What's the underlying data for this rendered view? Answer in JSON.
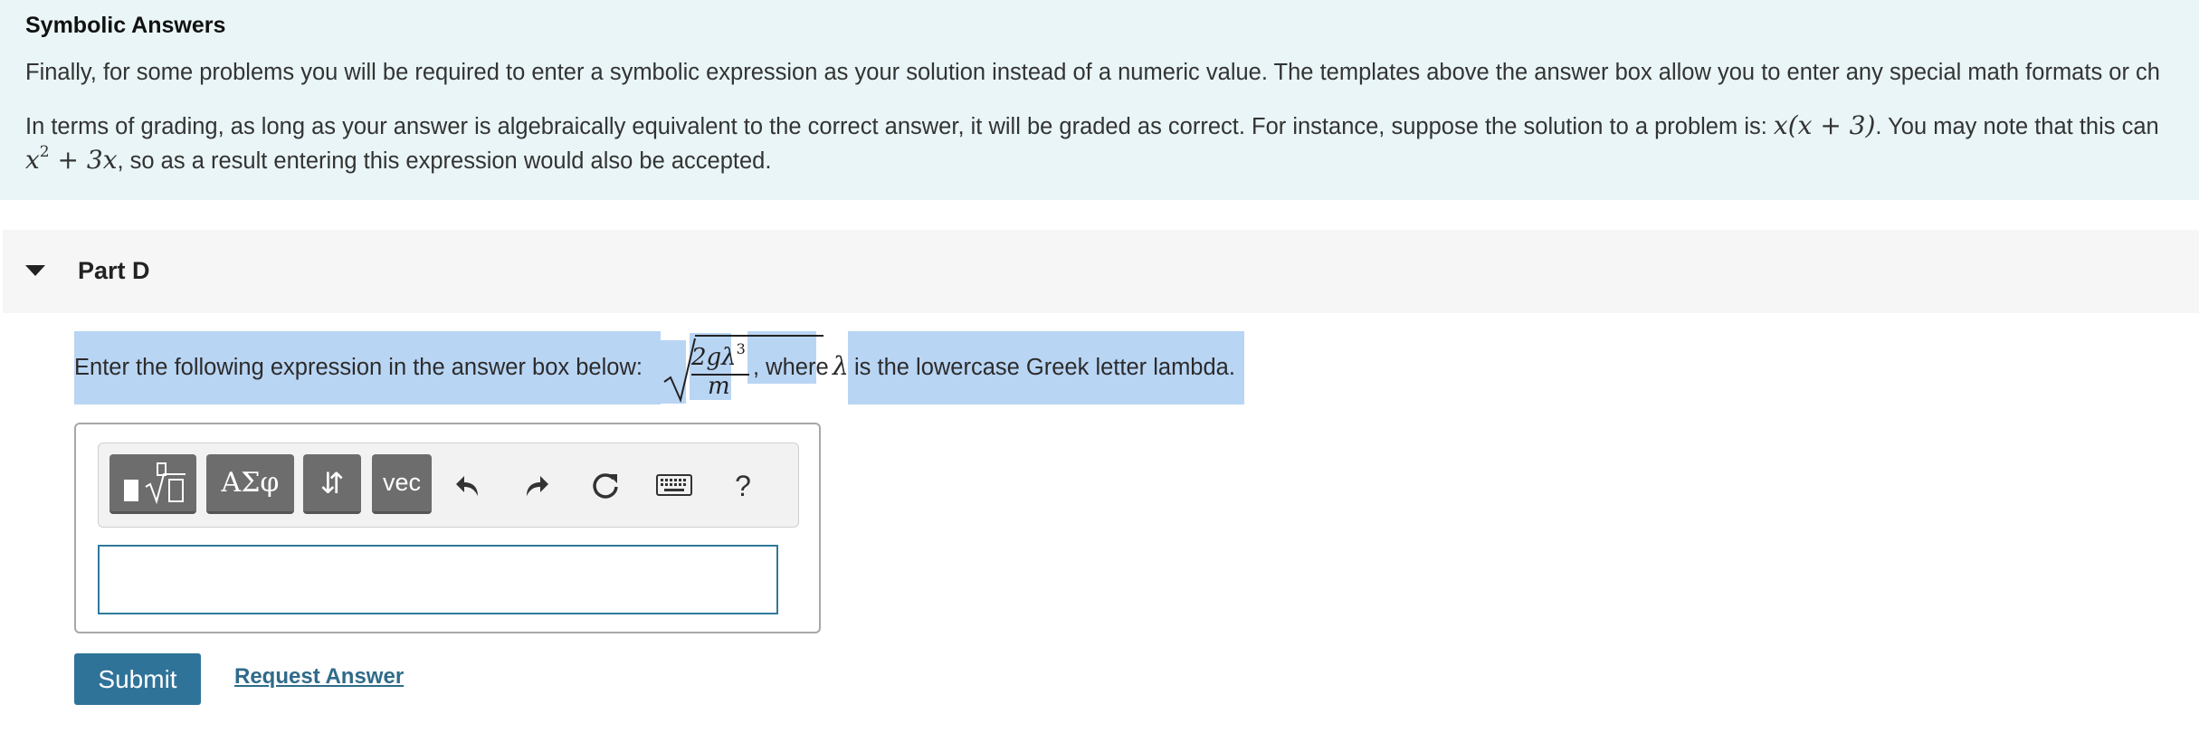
{
  "intro": {
    "title": "Symbolic Answers",
    "paragraph1": "Finally, for some problems you will be required to enter a symbolic expression as your solution instead of a numeric value. The templates above the answer box allow you to enter any special math formats or ch",
    "paragraph2_start": "In terms of grading, as long as your answer is algebraically equivalent to the correct answer, it will be graded as correct. For instance, suppose the solution to a problem is: ",
    "paragraph2_math": "x(x + 3)",
    "paragraph2_end": ". You may note that this can",
    "paragraph3_math_base": "x",
    "paragraph3_math_exp": "2",
    "paragraph3_math_rest": " + 3x",
    "paragraph3_end": ", so as a result entering this expression would also be accepted."
  },
  "part": {
    "title": "Part D",
    "prompt_start": "Enter the following expression in the answer box below: ",
    "expr_numerator": "2gλ",
    "expr_exponent": "3",
    "expr_denominator": "m",
    "prompt_middle": ", where ",
    "lambda": "λ",
    "prompt_end": " is the lowercase Greek letter lambda."
  },
  "toolbar": {
    "greek_label": "ΑΣφ",
    "arrows_label": "⇵",
    "vec_label": "vec",
    "help_label": "?",
    "icons": [
      "templates-icon",
      "undo-icon",
      "redo-icon",
      "reset-icon",
      "keyboard-icon",
      "help-icon"
    ]
  },
  "answer": {
    "value": ""
  },
  "actions": {
    "submit_label": "Submit",
    "request_label": "Request Answer"
  },
  "colors": {
    "intro_bg": "#e9f5f6",
    "highlight": "#b9d5f4",
    "accent": "#2f7399",
    "toolbar_button": "#6d6d6d"
  }
}
